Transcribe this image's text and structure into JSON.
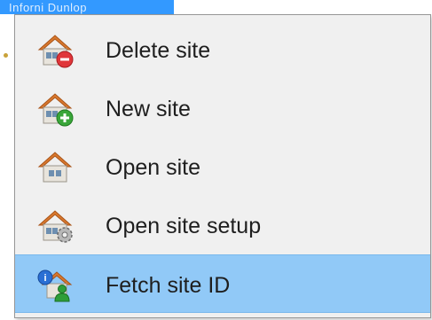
{
  "background": {
    "fragment_text": "Inforni Dunlop"
  },
  "menu": {
    "items": [
      {
        "label": "Delete site",
        "icon": "house-delete-icon",
        "highlighted": false
      },
      {
        "label": "New site",
        "icon": "house-add-icon",
        "highlighted": false
      },
      {
        "label": "Open site",
        "icon": "house-icon",
        "highlighted": false
      },
      {
        "label": "Open site setup",
        "icon": "house-settings-icon",
        "highlighted": false
      },
      {
        "label": "Fetch site ID",
        "icon": "house-id-user-icon",
        "highlighted": true
      }
    ]
  },
  "colors": {
    "menu_background": "#f0f0f0",
    "highlight": "#91c9f7",
    "text": "#1e1e1e",
    "roof": "#d9782e",
    "delete_badge": "#e0363a",
    "add_badge": "#3aa63a",
    "info_badge": "#2a6fd4",
    "user_badge": "#2e9e3a"
  }
}
